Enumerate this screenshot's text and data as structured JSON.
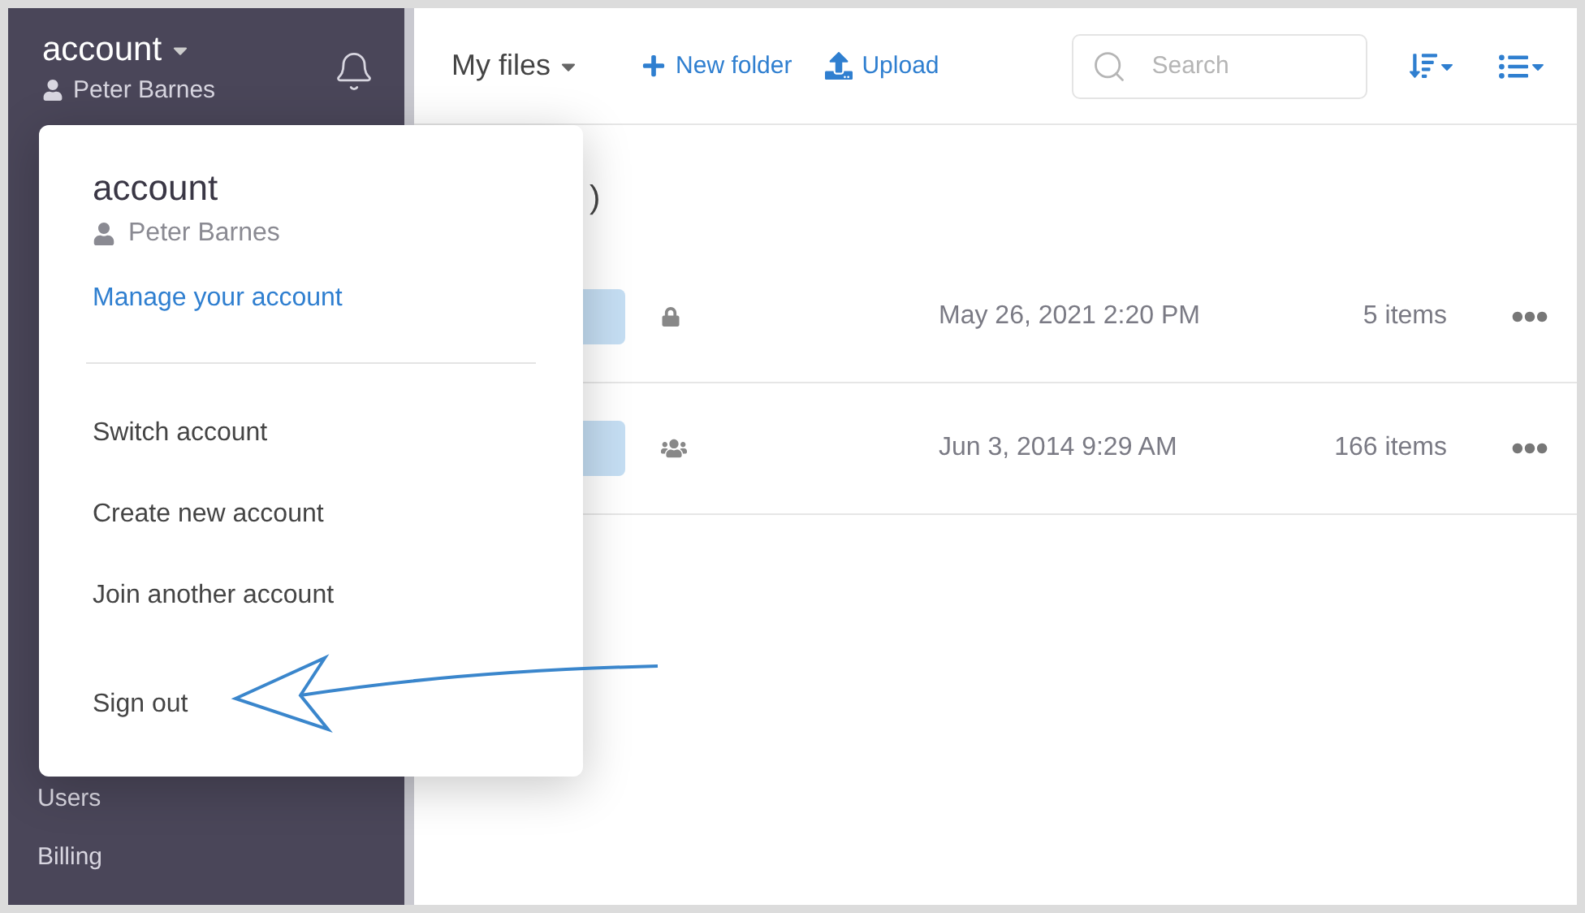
{
  "sidebar": {
    "account_name": "account",
    "user": "Peter Barnes",
    "items": [
      {
        "label": "Users"
      },
      {
        "label": "Billing"
      }
    ]
  },
  "toolbar": {
    "location": "My files",
    "new_folder": "New folder",
    "upload": "Upload",
    "search": {
      "placeholder": "Search"
    }
  },
  "heading_fragment": ")",
  "rows": [
    {
      "kind": "private",
      "date": "May 26, 2021 2:20 PM",
      "count": "5 items"
    },
    {
      "kind": "shared",
      "date": "Jun 3, 2014 9:29 AM",
      "count": "166 items"
    }
  ],
  "account_menu": {
    "title": "account",
    "user": "Peter Barnes",
    "manage_link": "Manage your account",
    "items": [
      {
        "label": "Switch account",
        "kind": "option"
      },
      {
        "label": "Create new account",
        "kind": "option"
      },
      {
        "label": "Join another account",
        "kind": "option"
      },
      {
        "label": "Sign out",
        "kind": "signout"
      }
    ]
  }
}
